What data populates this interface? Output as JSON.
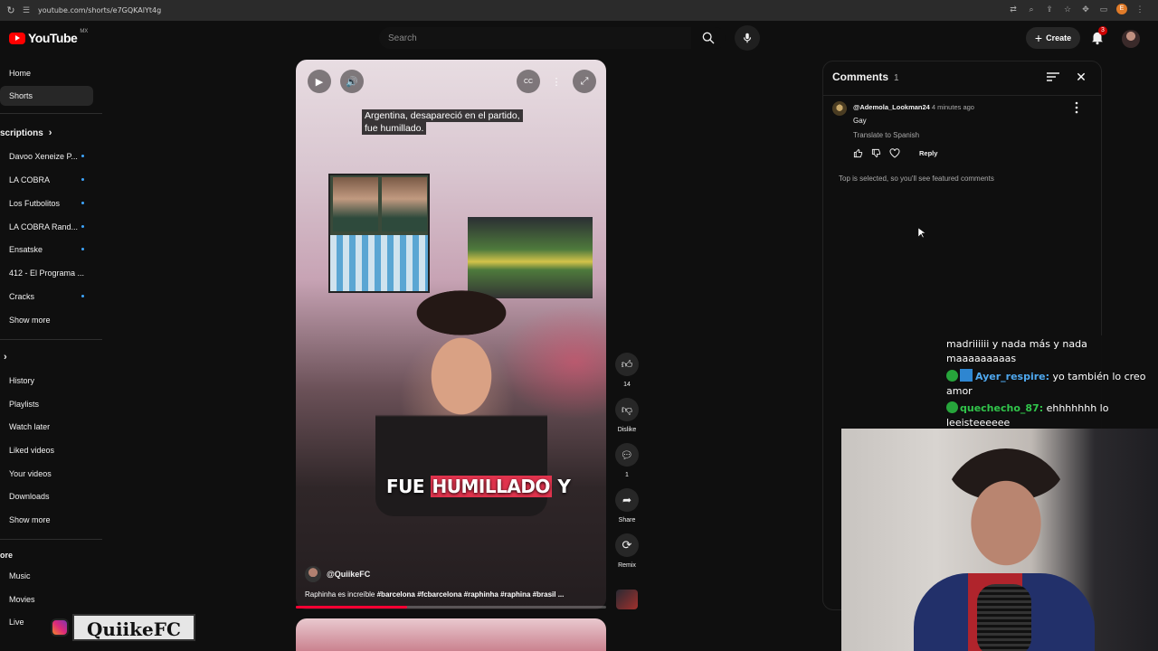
{
  "browser": {
    "url": "youtube.com/shorts/e7GQKAlYt4g"
  },
  "topbar": {
    "logo_text": "YouTube",
    "region": "MX",
    "search_placeholder": "Search",
    "create_label": "Create",
    "notification_count": "3"
  },
  "sidebar": {
    "main": [
      {
        "label": "Home"
      },
      {
        "label": "Shorts"
      }
    ],
    "subscriptions_title": "scriptions",
    "subscriptions": [
      {
        "label": "Davoo Xeneize P..."
      },
      {
        "label": "LA COBRA"
      },
      {
        "label": "Los Futbolitos"
      },
      {
        "label": "LA COBRA Rand..."
      },
      {
        "label": "Ensatske"
      },
      {
        "label": "412 - El Programa ..."
      },
      {
        "label": "Cracks"
      }
    ],
    "subs_show_more": "Show more",
    "you_items": [
      {
        "label": "History"
      },
      {
        "label": "Playlists"
      },
      {
        "label": "Watch later"
      },
      {
        "label": "Liked videos"
      },
      {
        "label": "Your videos"
      },
      {
        "label": "Downloads"
      }
    ],
    "you_show_more": "Show more",
    "explore_title": "ore",
    "explore_items": [
      {
        "label": "Music"
      },
      {
        "label": "Movies"
      },
      {
        "label": "Live"
      }
    ]
  },
  "short": {
    "caption_line1": "Argentina, desapareció en el partido,",
    "caption_line2": "fue humillado.",
    "big_caption_a": "FUE ",
    "big_caption_b": "HUMILLADO",
    "big_caption_c": " Y",
    "channel": "@QuiikeFC",
    "description_plain": "Raphinha es increíble ",
    "description_tags": "#barcelona #fcbarcelona #raphinha #raphina #brasil ...",
    "progress": 0.36
  },
  "actions": {
    "like_count": "14",
    "dislike_label": "Dislike",
    "comment_count": "1",
    "share_label": "Share",
    "remix_label": "Remix"
  },
  "comments": {
    "title": "Comments",
    "count": "1",
    "items": [
      {
        "user": "@Ademola_Lookman24",
        "time": "4 minutes ago",
        "text": "Gay",
        "translate": "Translate to Spanish",
        "reply_label": "Reply"
      }
    ],
    "notice": "Top is selected, so you'll see featured comments"
  },
  "stream_chat": {
    "line0": "madriiiiii y nada más y nada maaaaaaaaas",
    "msg1_user": "Ayer_respire:",
    "msg1_text": " yo también lo creo amor",
    "msg2_user": "quechecho_87:",
    "msg2_text": " ehhhhhhh lo leeisteeeeee"
  },
  "brand_overlay": {
    "name": "QuiikeFC"
  },
  "colors": {
    "youtube_red": "#ff0000",
    "caption_highlight": "#e0334d",
    "chat_user_green": "#31c54b",
    "chat_user_blue": "#4fa8ef"
  }
}
